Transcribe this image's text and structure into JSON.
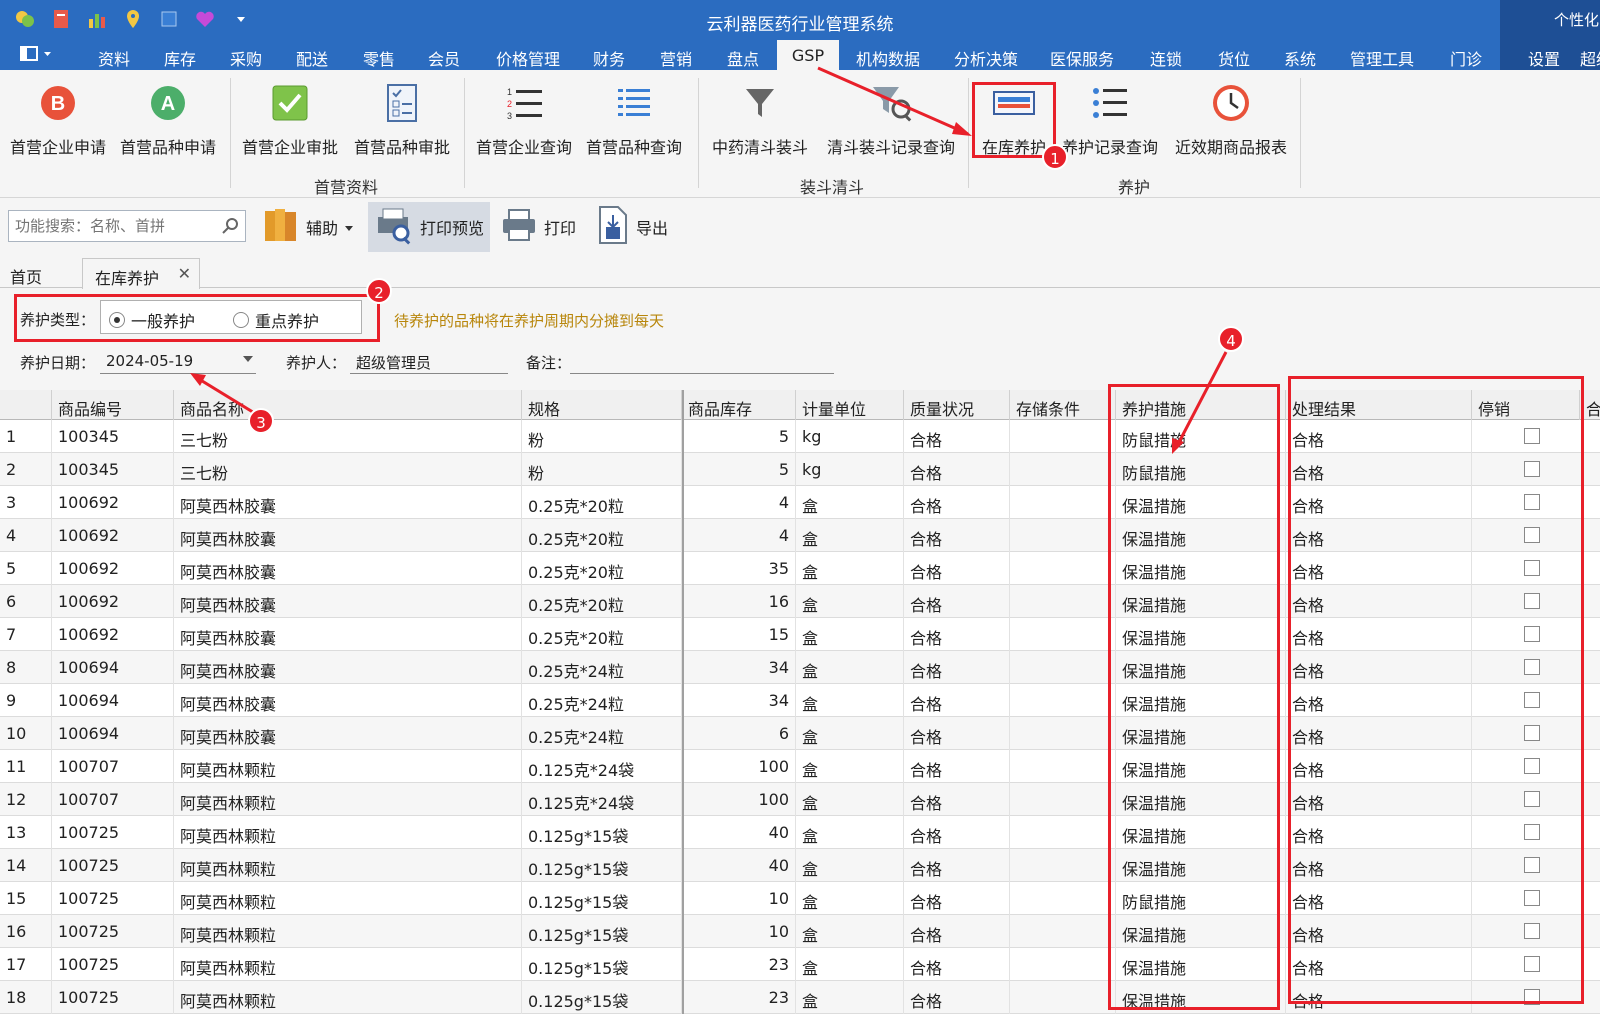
{
  "app": {
    "title": "云利器医药行业管理系统",
    "personal": "个性化"
  },
  "menu": [
    "资料",
    "库存",
    "采购",
    "配送",
    "零售",
    "会员",
    "价格管理",
    "财务",
    "营销",
    "盘点",
    "GSP",
    "机构数据",
    "分析决策",
    "医保服务",
    "连锁",
    "货位",
    "系统",
    "管理工具",
    "门诊",
    "设置",
    "超级"
  ],
  "ribbon": {
    "buttons": [
      "首营企业申请",
      "首营品种申请",
      "首营企业审批",
      "首营品种审批",
      "首营企业查询",
      "首营品种查询",
      "中药清斗装斗",
      "清斗装斗记录查询",
      "在库养护",
      "养护记录查询",
      "近效期商品报表"
    ],
    "groups": [
      "首营资料",
      "装斗清斗",
      "养护"
    ]
  },
  "toolbar": {
    "search_placeholder": "功能搜索：名称、首拼",
    "assist": "辅助",
    "print_preview": "打印预览",
    "print": "打印",
    "export": "导出"
  },
  "tabs": {
    "home": "首页",
    "active": "在库养护",
    "close": "✕"
  },
  "form": {
    "type_label": "养护类型：",
    "radio_general": "一般养护",
    "radio_key": "重点养护",
    "hint": "待养护的品种将在养护周期内分摊到每天",
    "date_label": "养护日期：",
    "date_value": "2024-05-19",
    "person_label": "养护人：",
    "person_value": "超级管理员",
    "note_label": "备注："
  },
  "grid": {
    "headers": [
      "商品编号",
      "商品名称",
      "规格",
      "商品库存",
      "计量单位",
      "质量状况",
      "存储条件",
      "养护措施",
      "处理结果",
      "停销",
      "合"
    ],
    "rows": [
      {
        "idx": "1",
        "code": "100345",
        "name": "三七粉",
        "spec": "粉",
        "stock": "5",
        "unit": "kg",
        "quality": "合格",
        "measure": "防鼠措施",
        "result": "合格"
      },
      {
        "idx": "2",
        "code": "100345",
        "name": "三七粉",
        "spec": "粉",
        "stock": "5",
        "unit": "kg",
        "quality": "合格",
        "measure": "防鼠措施",
        "result": "合格"
      },
      {
        "idx": "3",
        "code": "100692",
        "name": "阿莫西林胶囊",
        "spec": "0.25克*20粒",
        "stock": "4",
        "unit": "盒",
        "quality": "合格",
        "measure": "保温措施",
        "result": "合格"
      },
      {
        "idx": "4",
        "code": "100692",
        "name": "阿莫西林胶囊",
        "spec": "0.25克*20粒",
        "stock": "4",
        "unit": "盒",
        "quality": "合格",
        "measure": "保温措施",
        "result": "合格"
      },
      {
        "idx": "5",
        "code": "100692",
        "name": "阿莫西林胶囊",
        "spec": "0.25克*20粒",
        "stock": "35",
        "unit": "盒",
        "quality": "合格",
        "measure": "保温措施",
        "result": "合格"
      },
      {
        "idx": "6",
        "code": "100692",
        "name": "阿莫西林胶囊",
        "spec": "0.25克*20粒",
        "stock": "16",
        "unit": "盒",
        "quality": "合格",
        "measure": "保温措施",
        "result": "合格"
      },
      {
        "idx": "7",
        "code": "100692",
        "name": "阿莫西林胶囊",
        "spec": "0.25克*20粒",
        "stock": "15",
        "unit": "盒",
        "quality": "合格",
        "measure": "保温措施",
        "result": "合格"
      },
      {
        "idx": "8",
        "code": "100694",
        "name": "阿莫西林胶囊",
        "spec": "0.25克*24粒",
        "stock": "34",
        "unit": "盒",
        "quality": "合格",
        "measure": "保温措施",
        "result": "合格"
      },
      {
        "idx": "9",
        "code": "100694",
        "name": "阿莫西林胶囊",
        "spec": "0.25克*24粒",
        "stock": "34",
        "unit": "盒",
        "quality": "合格",
        "measure": "保温措施",
        "result": "合格"
      },
      {
        "idx": "10",
        "code": "100694",
        "name": "阿莫西林胶囊",
        "spec": "0.25克*24粒",
        "stock": "6",
        "unit": "盒",
        "quality": "合格",
        "measure": "保温措施",
        "result": "合格"
      },
      {
        "idx": "11",
        "code": "100707",
        "name": "阿莫西林颗粒",
        "spec": "0.125克*24袋",
        "stock": "100",
        "unit": "盒",
        "quality": "合格",
        "measure": "保温措施",
        "result": "合格"
      },
      {
        "idx": "12",
        "code": "100707",
        "name": "阿莫西林颗粒",
        "spec": "0.125克*24袋",
        "stock": "100",
        "unit": "盒",
        "quality": "合格",
        "measure": "保温措施",
        "result": "合格"
      },
      {
        "idx": "13",
        "code": "100725",
        "name": "阿莫西林颗粒",
        "spec": "0.125g*15袋",
        "stock": "40",
        "unit": "盒",
        "quality": "合格",
        "measure": "保温措施",
        "result": "合格"
      },
      {
        "idx": "14",
        "code": "100725",
        "name": "阿莫西林颗粒",
        "spec": "0.125g*15袋",
        "stock": "40",
        "unit": "盒",
        "quality": "合格",
        "measure": "保温措施",
        "result": "合格"
      },
      {
        "idx": "15",
        "code": "100725",
        "name": "阿莫西林颗粒",
        "spec": "0.125g*15袋",
        "stock": "10",
        "unit": "盒",
        "quality": "合格",
        "measure": "防鼠措施",
        "result": "合格"
      },
      {
        "idx": "16",
        "code": "100725",
        "name": "阿莫西林颗粒",
        "spec": "0.125g*15袋",
        "stock": "10",
        "unit": "盒",
        "quality": "合格",
        "measure": "保温措施",
        "result": "合格"
      },
      {
        "idx": "17",
        "code": "100725",
        "name": "阿莫西林颗粒",
        "spec": "0.125g*15袋",
        "stock": "23",
        "unit": "盒",
        "quality": "合格",
        "measure": "保温措施",
        "result": "合格"
      },
      {
        "idx": "18",
        "code": "100725",
        "name": "阿莫西林颗粒",
        "spec": "0.125g*15袋",
        "stock": "23",
        "unit": "盒",
        "quality": "合格",
        "measure": "保温措施",
        "result": "合格"
      }
    ]
  },
  "annotations": [
    "1",
    "2",
    "3",
    "4"
  ],
  "colors": {
    "titlebar": "#2b6cc0",
    "annotation": "#e8202a",
    "hint": "#b8860b"
  }
}
